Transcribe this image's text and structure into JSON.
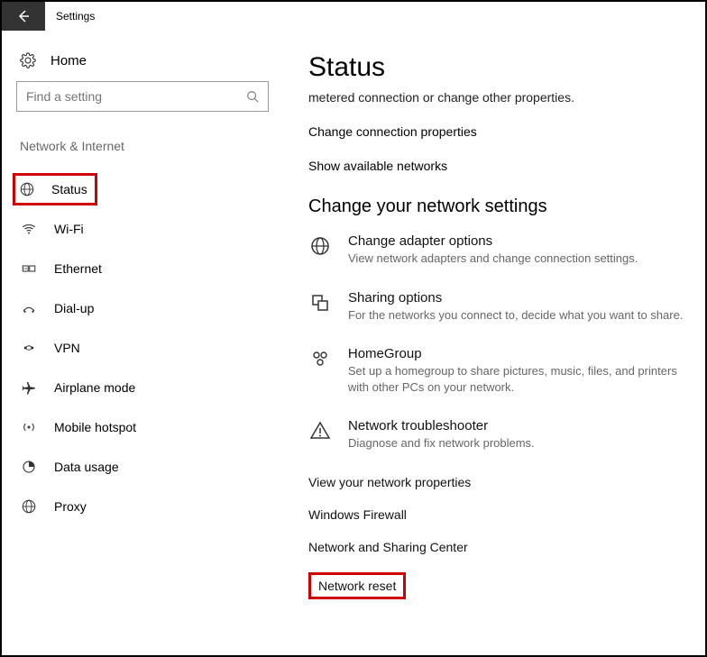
{
  "title": "Settings",
  "home_label": "Home",
  "search": {
    "placeholder": "Find a setting"
  },
  "section_label": "Network & Internet",
  "nav": {
    "status": "Status",
    "wifi": "Wi-Fi",
    "ethernet": "Ethernet",
    "dialup": "Dial-up",
    "vpn": "VPN",
    "airplane": "Airplane mode",
    "hotspot": "Mobile hotspot",
    "data": "Data usage",
    "proxy": "Proxy"
  },
  "main": {
    "page_title": "Status",
    "intro_line": "metered connection or change other properties.",
    "link_change_props": "Change connection properties",
    "link_show_networks": "Show available networks",
    "section_heading": "Change your network settings",
    "opt_adapter_title": "Change adapter options",
    "opt_adapter_sub": "View network adapters and change connection settings.",
    "opt_sharing_title": "Sharing options",
    "opt_sharing_sub": "For the networks you connect to, decide what you want to share.",
    "opt_homegroup_title": "HomeGroup",
    "opt_homegroup_sub": "Set up a homegroup to share pictures, music, files, and printers with other PCs on your network.",
    "opt_trouble_title": "Network troubleshooter",
    "opt_trouble_sub": "Diagnose and fix network problems.",
    "link_view_props": "View your network properties",
    "link_firewall": "Windows Firewall",
    "link_sharing_center": "Network and Sharing Center",
    "link_reset": "Network reset"
  }
}
